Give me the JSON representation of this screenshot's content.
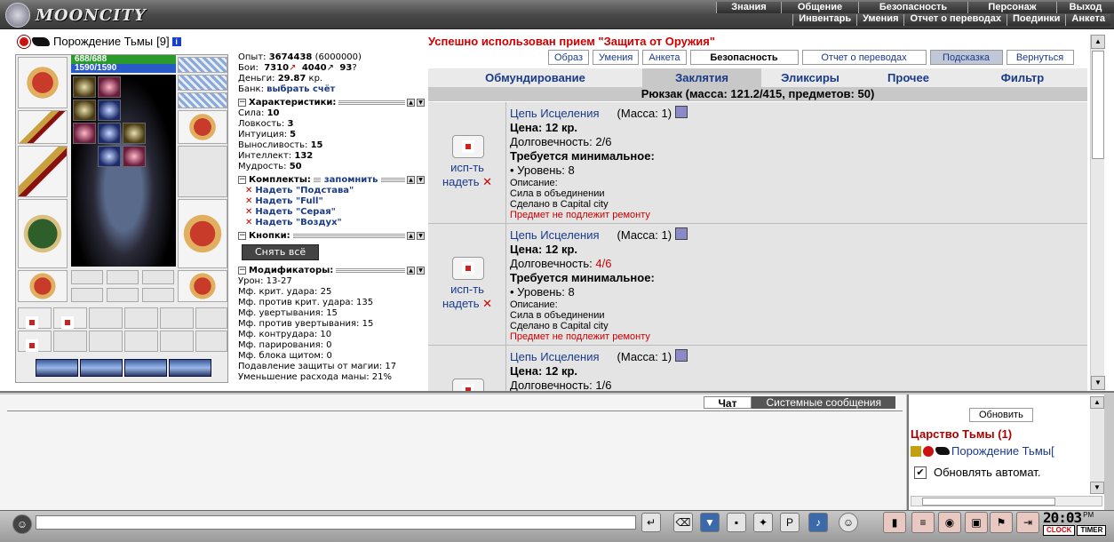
{
  "app": {
    "brand": "MOONCITY"
  },
  "menu_top": [
    "Знания",
    "Общение",
    "Безопасность",
    "Персонаж",
    "Выход"
  ],
  "menu_sub": [
    "Инвентарь",
    "Умения",
    "Отчет о переводах",
    "Поединки",
    "Анкета"
  ],
  "character": {
    "name": "Порождение Тьмы",
    "level": "[9]",
    "hp": "688/688",
    "mp": "1590/1590"
  },
  "stats": {
    "exp_label": "Опыт:",
    "exp_value": "3674438",
    "exp_next": "(6000000)",
    "fights_label": "Бои:",
    "fights_win": "7310",
    "fights_lose": "4040",
    "fights_draw": "93",
    "money_label": "Деньги:",
    "money_value": "29.87",
    "money_unit": "кр.",
    "bank_label": "Банк:",
    "bank_link": "выбрать счёт"
  },
  "characteristics": {
    "title": "Характеристики:",
    "rows": [
      {
        "label": "Сила:",
        "value": "10"
      },
      {
        "label": "Ловкость:",
        "value": "3"
      },
      {
        "label": "Интуиция:",
        "value": "5"
      },
      {
        "label": "Выносливость:",
        "value": "15"
      },
      {
        "label": "Интеллект:",
        "value": "132"
      },
      {
        "label": "Мудрость:",
        "value": "50"
      }
    ]
  },
  "kits": {
    "title": "Комплекты:",
    "remember": "запомнить",
    "items": [
      "Надеть \"Подстава\"",
      "Надеть \"Full\"",
      "Надеть \"Серая\"",
      "Надеть \"Воздух\""
    ]
  },
  "buttons_section": {
    "title": "Кнопки:",
    "undress": "Снять всё"
  },
  "modifiers": {
    "title": "Модификаторы:",
    "rows": [
      "Урон: 13-27",
      "Мф. крит. удара: 25",
      "Мф. против крит. удара: 135",
      "Мф. увертывания: 15",
      "Мф. против увертывания: 15",
      "Мф. контрудара: 10",
      "Мф. парирования: 0",
      "Мф. блока щитом: 0",
      "Подавление защиты от магии: 17",
      "Уменьшение расхода маны: 21%"
    ]
  },
  "message": {
    "success": "Успешно использован прием \"Защита от Оружия\""
  },
  "nav_buttons": [
    "Образ",
    "Умения",
    "Анкета",
    "Безопасность",
    "Отчет о переводах",
    "Подсказка",
    "Вернуться"
  ],
  "tabs": [
    "Обмундирование",
    "Заклятия",
    "Эликсиры",
    "Прочее",
    "Фильтр"
  ],
  "bag": {
    "title": "Рюкзак (масса: 121.2/415, предметов: 50)"
  },
  "items": [
    {
      "use": "исп-ть",
      "wear": "надеть",
      "name": "Цепь Исцеления",
      "mass": "(Масса: 1)",
      "price": "Цена: 12 кр.",
      "durability_label": "Долговечность:",
      "durability": "2/6",
      "durability_red": false,
      "req": "Требуется минимальное:",
      "level": "• Уровень: 8",
      "desc_label": "Описание:",
      "desc": "Сила в объединении",
      "made": "Сделано в Capital city",
      "repair": "Предмет не подлежит ремонту"
    },
    {
      "use": "исп-ть",
      "wear": "надеть",
      "name": "Цепь Исцеления",
      "mass": "(Масса: 1)",
      "price": "Цена: 12 кр.",
      "durability_label": "Долговечность:",
      "durability": "4/6",
      "durability_red": true,
      "req": "Требуется минимальное:",
      "level": "• Уровень: 8",
      "desc_label": "Описание:",
      "desc": "Сила в объединении",
      "made": "Сделано в Capital city",
      "repair": "Предмет не подлежит ремонту"
    },
    {
      "use": "исп-ть",
      "wear": "надеть",
      "name": "Цепь Исцеления",
      "mass": "(Масса: 1)",
      "price": "Цена: 12 кр.",
      "durability_label": "Долговечность:",
      "durability": "1/6",
      "durability_red": false,
      "req": "",
      "level": "",
      "desc_label": "",
      "desc": "",
      "made": "",
      "repair": ""
    }
  ],
  "chat": {
    "tab_chat": "Чат",
    "tab_system": "Системные сообщения"
  },
  "online": {
    "refresh": "Обновить",
    "room": "Царство Тьмы (1)",
    "user": "Порождение Тьмы[",
    "auto": "Обновлять автомат."
  },
  "clock": {
    "time": "20:03",
    "ampm": "PM",
    "clock_tag": "CLOCK",
    "timer_tag": "TIMER"
  },
  "icons": {
    "check": "✔",
    "close": "✕",
    "scroll_up": "▲",
    "scroll_down": "▼"
  }
}
